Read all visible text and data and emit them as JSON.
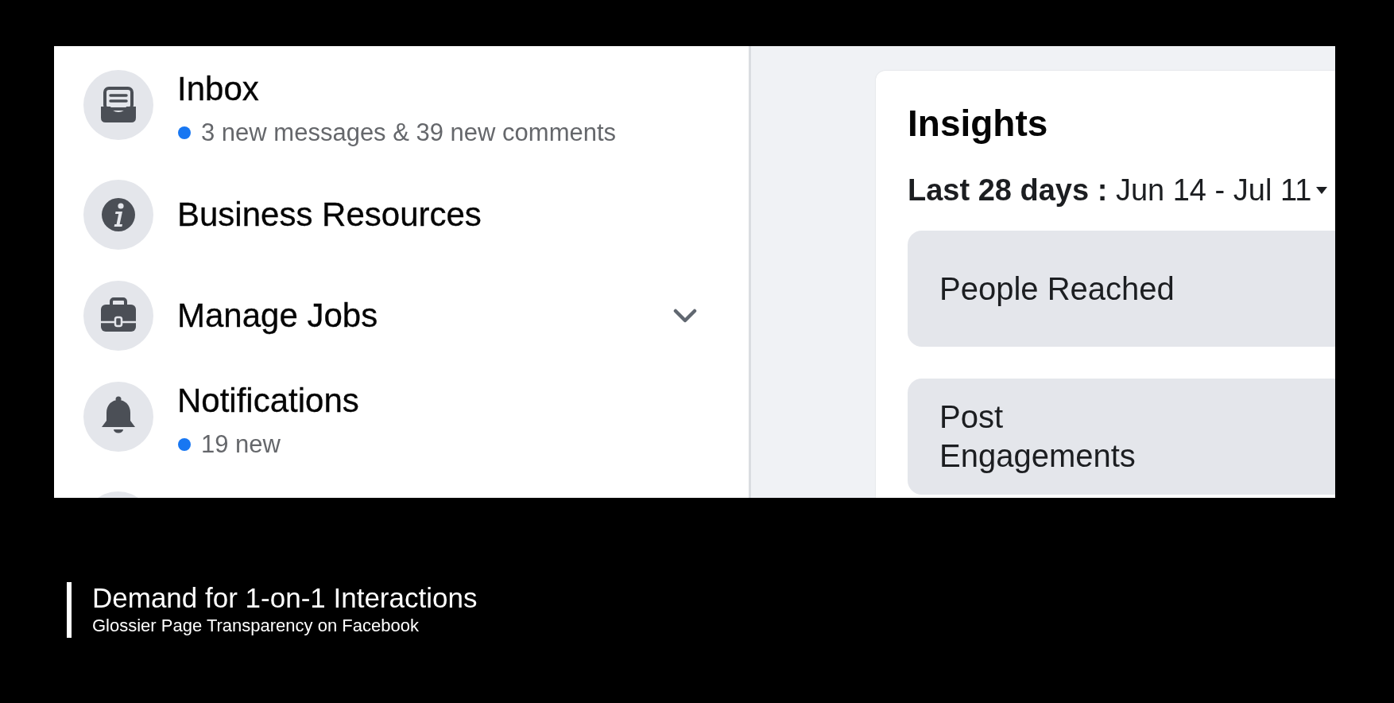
{
  "sidebar": {
    "items": [
      {
        "title": "Inbox",
        "subtitle": "3 new messages & 39 new comments",
        "unread": true,
        "expandable": false
      },
      {
        "title": "Business Resources",
        "unread": false,
        "expandable": false
      },
      {
        "title": "Manage Jobs",
        "unread": false,
        "expandable": true
      },
      {
        "title": "Notifications",
        "subtitle": "19 new",
        "unread": true,
        "expandable": false
      }
    ]
  },
  "insights": {
    "title": "Insights",
    "date_range": "**Last 28 days :** Jun 14 - Jul 11",
    "metrics": [
      {
        "label": "People Reached"
      },
      {
        "label": "Post\nEngagements"
      }
    ]
  },
  "caption": {
    "title": "Demand for 1-on-1 Interactions",
    "subtitle": "Glossier Page Transparency on Facebook"
  }
}
